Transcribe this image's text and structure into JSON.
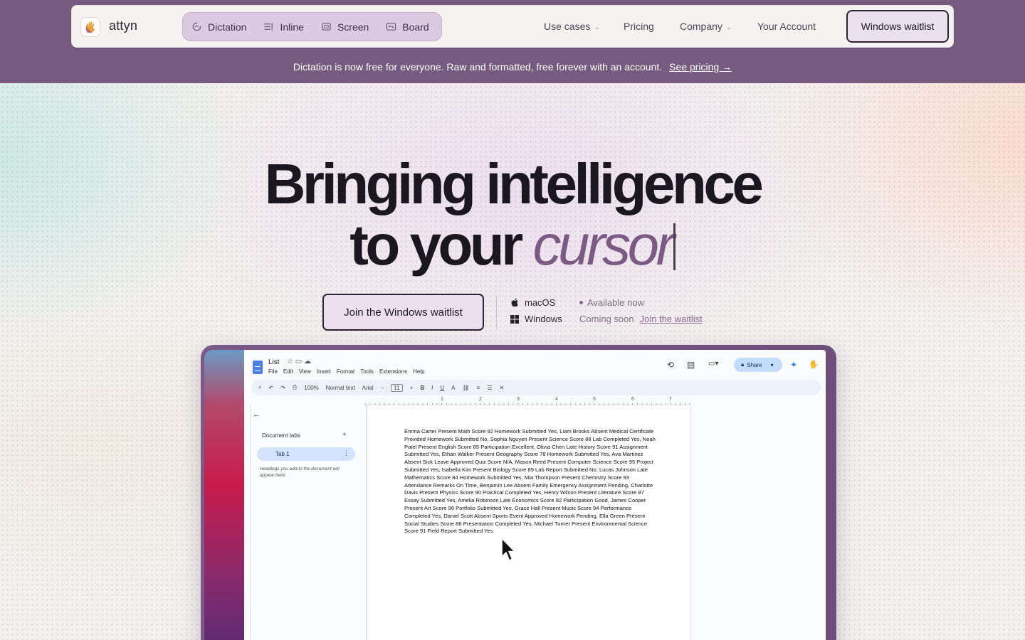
{
  "brand": {
    "name": "attyn"
  },
  "modes": [
    {
      "label": "Dictation",
      "icon": "dictation-icon"
    },
    {
      "label": "Inline",
      "icon": "inline-icon"
    },
    {
      "label": "Screen",
      "icon": "screen-icon"
    },
    {
      "label": "Board",
      "icon": "board-icon"
    }
  ],
  "nav": {
    "use_cases": "Use cases",
    "pricing": "Pricing",
    "company": "Company",
    "account": "Your Account",
    "waitlist_button": "Windows waitlist"
  },
  "announcement": {
    "text": "Dictation is now free for everyone. Raw and formatted, free forever with an account.",
    "link": "See pricing →"
  },
  "hero": {
    "line1": "Bringing intelligence",
    "line2_prefix": "to your",
    "line2_accent": "cursor"
  },
  "cta": {
    "label": "Join the Windows waitlist"
  },
  "platforms": {
    "macos": {
      "name": "macOS",
      "status": "Available now"
    },
    "windows": {
      "name": "Windows",
      "status": "Coming soon",
      "link": "Join the waitlist"
    }
  },
  "colors": {
    "band": "#775a80",
    "accent": "#7b5a83",
    "pill": "#dccbe0"
  },
  "doc": {
    "title": "List",
    "menu": [
      "File",
      "Edit",
      "View",
      "Insert",
      "Format",
      "Tools",
      "Extensions",
      "Help"
    ],
    "share": "Share",
    "toolbar": {
      "zoom": "100%",
      "style": "Normal text",
      "font": "Arial",
      "size": "11"
    },
    "ruler_numbers": [
      "1",
      "1",
      "2",
      "3",
      "4",
      "5",
      "6",
      "7"
    ],
    "sidebar": {
      "title": "Document tabs",
      "tab": "Tab 1",
      "hint": "Headings you add to the document will appear here."
    },
    "body": "Emma Carter Present Math Score 92 Homework Submitted Yes, Liam Brooks Absent Medical Certificate Provided Homework Submitted No, Sophia Nguyen Present Science Score 88 Lab Completed Yes, Noah Patel Present English Score 85 Participation Excellent, Olivia Chen Late History Score 91 Assignment Submitted Yes, Ethan Walker Present Geography Score 78 Homework Submitted Yes, Ava Martinez Absent Sick Leave Approved Quiz Score N/A, Mason Reed Present Computer Science Score 95 Project Submitted Yes, Isabella Kim Present Biology Score 89 Lab Report Submitted No, Lucas Johnson Late Mathematics Score 84 Homework Submitted Yes, Mia Thompson Present Chemistry Score 93 Attendance Remarks On Time, Benjamin Lee Absent Family Emergency Assignment Pending, Charlotte Davis Present Physics Score 90 Practical Completed Yes, Henry Wilson Present Literature Score 87 Essay Submitted Yes, Amelia Robinson Late Economics Score 82 Participation Good, James Cooper Present Art Score 96 Portfolio Submitted Yes, Grace Hall Present Music Score 94 Performance Completed Yes, Daniel Scott Absent Sports Event Approved Homework Pending, Ella Green Present Social Studies Score 86 Presentation Completed Yes, Michael Turner Present Environmental Science Score 91 Field Report Submitted Yes"
  }
}
